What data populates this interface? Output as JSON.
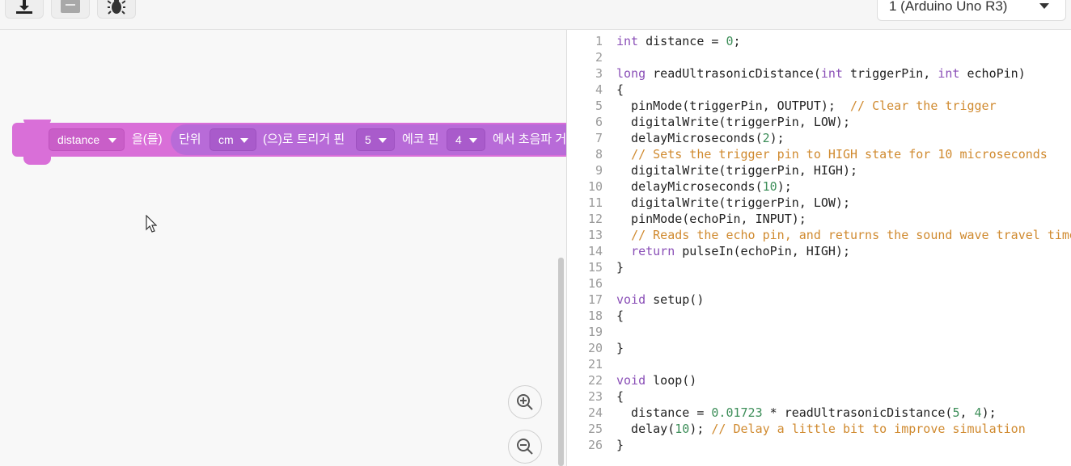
{
  "toolbar": {
    "buttons": [
      {
        "name": "download-icon"
      },
      {
        "name": "library-icon"
      },
      {
        "name": "debug-bug-icon"
      }
    ],
    "device_select": {
      "value": "1 (Arduino Uno R3)"
    }
  },
  "block": {
    "variable": "distance",
    "to_label": "을(를)",
    "unit_label": "단위",
    "unit_value": "cm",
    "trigger_label": "(으)로 트리거 핀",
    "trigger_value": "5",
    "echo_label": "에코 핀",
    "echo_value": "4",
    "tail_label": "에서 초음파 거"
  },
  "zoom": {
    "in_icon": "zoom-in-icon",
    "out_icon": "zoom-out-icon"
  },
  "code": {
    "lines": [
      "int distance = 0;",
      "",
      "long readUltrasonicDistance(int triggerPin, int echoPin)",
      "{",
      "  pinMode(triggerPin, OUTPUT);  // Clear the trigger",
      "  digitalWrite(triggerPin, LOW);",
      "  delayMicroseconds(2);",
      "  // Sets the trigger pin to HIGH state for 10 microseconds",
      "  digitalWrite(triggerPin, HIGH);",
      "  delayMicroseconds(10);",
      "  digitalWrite(triggerPin, LOW);",
      "  pinMode(echoPin, INPUT);",
      "  // Reads the echo pin, and returns the sound wave travel time",
      "  return pulseIn(echoPin, HIGH);",
      "}",
      "",
      "void setup()",
      "{",
      "",
      "}",
      "",
      "void loop()",
      "{",
      "  distance = 0.01723 * readUltrasonicDistance(5, 4);",
      "  delay(10); // Delay a little bit to improve simulation",
      "}"
    ]
  },
  "colors": {
    "block": "#d96fd8",
    "reporter": "#b86bd8",
    "keyword": "#8a4fb7",
    "number": "#3d8e59",
    "comment": "#d08a2f"
  }
}
